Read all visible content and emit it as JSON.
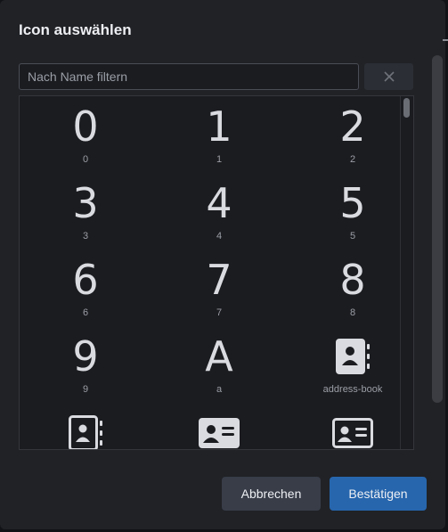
{
  "dialog": {
    "title": "Icon auswählen",
    "filter_placeholder": "Nach Name filtern",
    "clear_icon": "close-icon"
  },
  "icons": [
    {
      "glyph": "0",
      "label": "0"
    },
    {
      "glyph": "1",
      "label": "1"
    },
    {
      "glyph": "2",
      "label": "2"
    },
    {
      "glyph": "3",
      "label": "3"
    },
    {
      "glyph": "4",
      "label": "4"
    },
    {
      "glyph": "5",
      "label": "5"
    },
    {
      "glyph": "6",
      "label": "6"
    },
    {
      "glyph": "7",
      "label": "7"
    },
    {
      "glyph": "8",
      "label": "8"
    },
    {
      "glyph": "9",
      "label": "9"
    },
    {
      "glyph": "A",
      "label": "a"
    },
    {
      "glyph": "",
      "label": "address-book",
      "icon": "address-book-icon"
    },
    {
      "glyph": "",
      "label": "",
      "icon": "address-book-icon"
    },
    {
      "glyph": "",
      "label": "",
      "icon": "address-card-icon"
    },
    {
      "glyph": "",
      "label": "",
      "icon": "address-card-outline-icon"
    }
  ],
  "buttons": {
    "cancel": "Abbrechen",
    "confirm": "Bestätigen"
  },
  "colors": {
    "dialog_bg": "#202226",
    "confirm": "#2766ad",
    "cancel": "#383d48",
    "icon": "#d9dbe0"
  }
}
